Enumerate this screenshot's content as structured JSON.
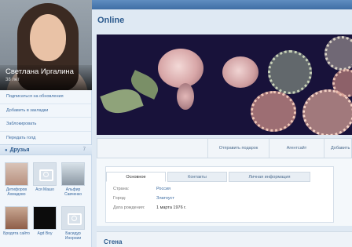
{
  "profile": {
    "name": "Светлана Иргалина",
    "age": "38 лет"
  },
  "sidebar": {
    "menu": [
      "Подписаться на обновления",
      "Добавить в закладки",
      "Заблокировать",
      "Передать голд"
    ],
    "friends_title": "Друзья",
    "friends_count": "7",
    "friends": [
      {
        "name": "Детифоров Ахмадово",
        "photo": "baby"
      },
      {
        "name": "Ася Машо",
        "photo": "camera"
      },
      {
        "name": "Альфир Савченко",
        "photo": "man"
      },
      {
        "name": "Бродята сайто",
        "photo": "child"
      },
      {
        "name": "Agd Boy",
        "photo": "black"
      },
      {
        "name": "Басидур Инорнии",
        "photo": "camera"
      }
    ]
  },
  "main": {
    "status": "Online",
    "actions": [
      "Отправить подарок",
      "Агентсайт",
      "Добавить"
    ],
    "tabs": [
      "Основное",
      "Контакты",
      "Личная информация"
    ],
    "info": [
      {
        "label": "Страна:",
        "value": "Россия",
        "link": true
      },
      {
        "label": "Город:",
        "value": "Златоуст",
        "link": true
      },
      {
        "label": "Дата рождения:",
        "value": "1 марта 1976 г.",
        "link": false
      }
    ],
    "wall_title": "Стена"
  },
  "colors": {
    "accent": "#2c5a8d",
    "link": "#3a6aa0",
    "topbar": "#4a78ae"
  }
}
